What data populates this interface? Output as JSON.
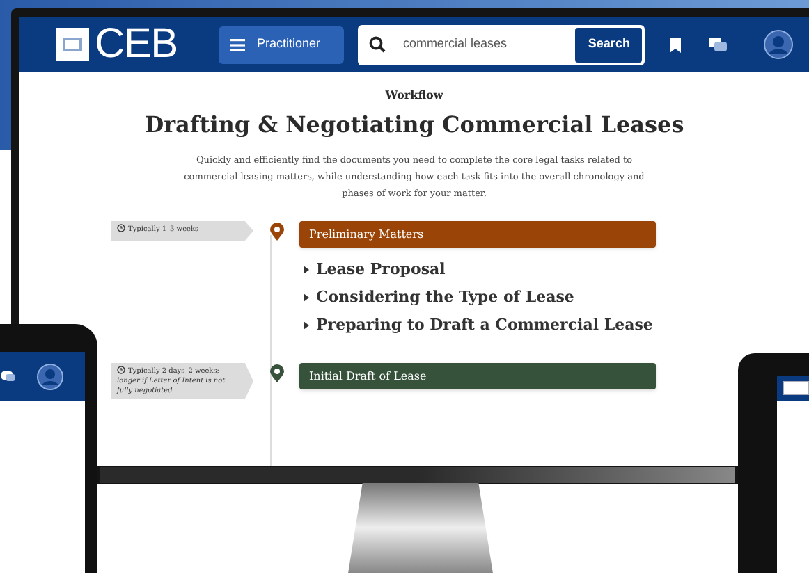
{
  "header": {
    "logo": "CEB",
    "menu_button": "Practitioner",
    "search": {
      "value": "commercial leases",
      "button": "Search"
    }
  },
  "page": {
    "eyebrow": "Workflow",
    "title": "Drafting & Negotiating Commercial Leases",
    "description": "Quickly and efficiently find the documents you need to complete the core legal tasks related to commercial leasing matters, while understanding how each task fits into the overall chronology and phases of work for your matter."
  },
  "phases": [
    {
      "duration": "Typically 1–3 weeks",
      "title": "Preliminary Matters",
      "color": "#9a4407",
      "tasks": [
        "Lease Proposal",
        "Considering the Type of Lease",
        "Preparing to Draft a Commercial Lease"
      ]
    },
    {
      "duration": "Typically 2 days–2 weeks; *longer if Letter of Intent is not fully negotiated*",
      "title": "Initial Draft of Lease",
      "color": "#36523a"
    }
  ]
}
